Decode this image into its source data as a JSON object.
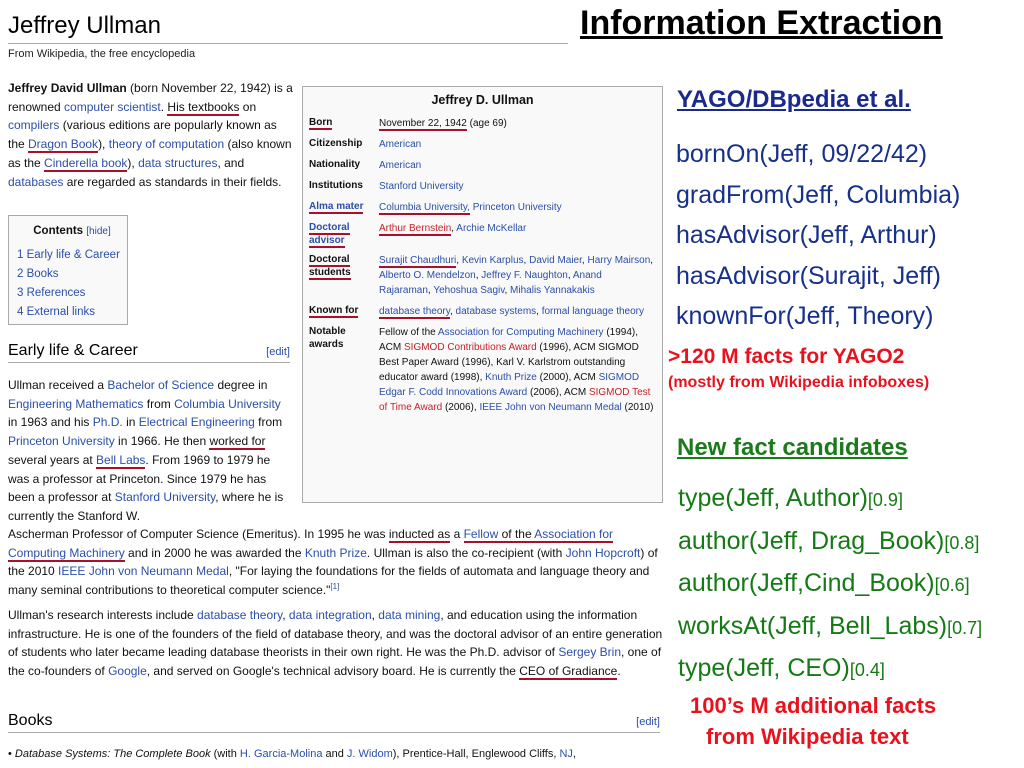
{
  "slide_title": "Information Extraction",
  "wiki": {
    "title": "Jeffrey Ullman",
    "subtitle": "From Wikipedia, the free encyclopedia",
    "intro": [
      {
        "t": "Jeffrey David Ullman",
        "k": "b"
      },
      {
        "t": " (born November 22, 1942) is a renowned ",
        "k": ""
      },
      {
        "t": "computer scientist",
        "k": "l"
      },
      {
        "t": ". ",
        "k": ""
      },
      {
        "t": "His textbooks",
        "k": "u"
      },
      {
        "t": " on ",
        "k": ""
      },
      {
        "t": "compilers",
        "k": "l"
      },
      {
        "t": " (various editions are popularly known as the ",
        "k": ""
      },
      {
        "t": "Dragon Book",
        "k": "l u"
      },
      {
        "t": "), ",
        "k": ""
      },
      {
        "t": "theory of computation",
        "k": "l"
      },
      {
        "t": " (also known as the ",
        "k": ""
      },
      {
        "t": "Cinderella book",
        "k": "l u"
      },
      {
        "t": "), ",
        "k": ""
      },
      {
        "t": "data structures",
        "k": "l"
      },
      {
        "t": ", and ",
        "k": ""
      },
      {
        "t": "databases",
        "k": "l"
      },
      {
        "t": " are regarded as standards in their fields.",
        "k": ""
      }
    ],
    "toc": {
      "title": "Contents",
      "hide": "[hide]",
      "items": [
        "1 Early life & Career",
        "2 Books",
        "3 References",
        "4 External links"
      ]
    },
    "early_heading": "Early life & Career",
    "edit_label": "[edit]",
    "early_para": [
      {
        "t": "Ullman received a ",
        "k": ""
      },
      {
        "t": "Bachelor of Science",
        "k": "l"
      },
      {
        "t": " degree in ",
        "k": ""
      },
      {
        "t": "Engineering Mathematics",
        "k": "l"
      },
      {
        "t": " from ",
        "k": ""
      },
      {
        "t": "Columbia University",
        "k": "l"
      },
      {
        "t": " in 1963 and his ",
        "k": ""
      },
      {
        "t": "Ph.D.",
        "k": "l"
      },
      {
        "t": " in ",
        "k": ""
      },
      {
        "t": "Electrical Engineering",
        "k": "l"
      },
      {
        "t": " from ",
        "k": ""
      },
      {
        "t": "Princeton University",
        "k": "l"
      },
      {
        "t": " in 1966. He then ",
        "k": ""
      },
      {
        "t": "worked for",
        "k": "u"
      },
      {
        "t": " several years at ",
        "k": ""
      },
      {
        "t": "Bell Labs",
        "k": "l u"
      },
      {
        "t": ". From 1969 to 1979 he was a professor at Princeton. Since 1979 he has been a professor at ",
        "k": ""
      },
      {
        "t": "Stanford University",
        "k": "l"
      },
      {
        "t": ", where he is currently the Stanford W.",
        "k": ""
      }
    ],
    "early_para2": [
      {
        "t": "Ascherman Professor of Computer Science (Emeritus). In 1995 he was ",
        "k": ""
      },
      {
        "t": "inducted as",
        "k": "u"
      },
      {
        "t": " a ",
        "k": ""
      },
      {
        "t": "Fellow",
        "k": "l u"
      },
      {
        "t": " of the ",
        "k": "u"
      },
      {
        "t": "Association for Computing Machinery",
        "k": "l u"
      },
      {
        "t": " and in 2000 he was awarded the ",
        "k": ""
      },
      {
        "t": "Knuth Prize",
        "k": "l"
      },
      {
        "t": ". Ullman is also the co-recipient (with ",
        "k": ""
      },
      {
        "t": "John Hopcroft",
        "k": "l"
      },
      {
        "t": ") of the 2010 ",
        "k": ""
      },
      {
        "t": "IEEE John von Neumann Medal",
        "k": "l"
      },
      {
        "t": ", \"For laying the foundations for the fields of automata and language theory and many seminal contributions to theoretical computer science.\"",
        "k": ""
      },
      {
        "t": "[1]",
        "k": "sup"
      }
    ],
    "research_para": [
      {
        "t": "Ullman's research interests include ",
        "k": ""
      },
      {
        "t": "database theory",
        "k": "l"
      },
      {
        "t": ", ",
        "k": ""
      },
      {
        "t": "data integration",
        "k": "l"
      },
      {
        "t": ", ",
        "k": ""
      },
      {
        "t": "data mining",
        "k": "l"
      },
      {
        "t": ", and education using the information infrastructure. He is one of the founders of the field of database theory, and was the doctoral advisor of an entire generation of students who later became leading database theorists in their own right. He was the Ph.D. advisor of ",
        "k": ""
      },
      {
        "t": "Sergey Brin",
        "k": "l"
      },
      {
        "t": ", one of the co-founders of ",
        "k": ""
      },
      {
        "t": "Google",
        "k": "l"
      },
      {
        "t": ", and served on Google's technical advisory board. He is currently the ",
        "k": ""
      },
      {
        "t": "CEO of Gradiance",
        "k": "u"
      },
      {
        "t": ".",
        "k": ""
      }
    ],
    "books_heading": "Books",
    "book_item": [
      {
        "t": "•  ",
        "k": ""
      },
      {
        "t": "Database Systems: The Complete Book",
        "k": "i"
      },
      {
        "t": " (with ",
        "k": ""
      },
      {
        "t": "H. Garcia-Molina",
        "k": "l"
      },
      {
        "t": " and ",
        "k": ""
      },
      {
        "t": "J. Widom",
        "k": "l"
      },
      {
        "t": "), Prentice-Hall, Englewood Cliffs, ",
        "k": ""
      },
      {
        "t": "NJ",
        "k": "l"
      },
      {
        "t": ",",
        "k": ""
      }
    ],
    "infobox": {
      "title": "Jeffrey D. Ullman",
      "rows": [
        {
          "label": "Born",
          "label_mark": true,
          "label_link": false,
          "value": [
            {
              "t": "November 22, 1942",
              "k": "u"
            },
            {
              "t": " (age 69)",
              "k": ""
            }
          ]
        },
        {
          "label": "Citizenship",
          "label_mark": false,
          "label_link": false,
          "value": [
            {
              "t": "American",
              "k": "l"
            }
          ]
        },
        {
          "label": "Nationality",
          "label_mark": false,
          "label_link": false,
          "value": [
            {
              "t": "American",
              "k": "l"
            }
          ]
        },
        {
          "label": "Institutions",
          "label_mark": false,
          "label_link": false,
          "value": [
            {
              "t": "Stanford University",
              "k": "l"
            }
          ]
        },
        {
          "label": "Alma mater",
          "label_mark": true,
          "label_link": true,
          "value": [
            {
              "t": "Columbia University,",
              "k": "l u"
            },
            {
              "t": " Princeton University",
              "k": "l"
            }
          ]
        },
        {
          "label": "Doctoral advisor",
          "label_mark": true,
          "label_link": true,
          "value": [
            {
              "t": "Arthur Bernstein",
              "k": "r u"
            },
            {
              "t": ", ",
              "k": ""
            },
            {
              "t": "Archie McKellar",
              "k": "l"
            }
          ]
        },
        {
          "label": "Doctoral students",
          "label_mark": true,
          "label_link": false,
          "value": [
            {
              "t": "Surajit Chaudhuri",
              "k": "l u"
            },
            {
              "t": ", ",
              "k": ""
            },
            {
              "t": "Kevin Karplus",
              "k": "l"
            },
            {
              "t": ", ",
              "k": ""
            },
            {
              "t": "David Maier",
              "k": "l"
            },
            {
              "t": ", ",
              "k": ""
            },
            {
              "t": "Harry Mairson",
              "k": "l"
            },
            {
              "t": ", ",
              "k": ""
            },
            {
              "t": "Alberto O. Mendelzon",
              "k": "l"
            },
            {
              "t": ", ",
              "k": ""
            },
            {
              "t": "Jeffrey F. Naughton",
              "k": "l"
            },
            {
              "t": ", ",
              "k": ""
            },
            {
              "t": "Anand Rajaraman",
              "k": "l"
            },
            {
              "t": ", ",
              "k": ""
            },
            {
              "t": "Yehoshua Sagiv",
              "k": "l"
            },
            {
              "t": ", ",
              "k": ""
            },
            {
              "t": "Mihalis Yannakakis",
              "k": "l"
            }
          ]
        },
        {
          "label": "Known for",
          "label_mark": true,
          "label_link": false,
          "value": [
            {
              "t": "database theory",
              "k": "l u"
            },
            {
              "t": ", ",
              "k": ""
            },
            {
              "t": "database systems",
              "k": "l"
            },
            {
              "t": ", ",
              "k": ""
            },
            {
              "t": "formal language theory",
              "k": "l"
            }
          ]
        },
        {
          "label": "Notable awards",
          "label_mark": false,
          "label_link": false,
          "value": [
            {
              "t": "Fellow of the ",
              "k": ""
            },
            {
              "t": "Association for Computing Machinery",
              "k": "l"
            },
            {
              "t": " (1994), ACM ",
              "k": ""
            },
            {
              "t": "SIGMOD Contributions Award",
              "k": "r"
            },
            {
              "t": " (1996), ACM SIGMOD Best Paper Award (1996), Karl V. Karlstrom outstanding educator award (1998), ",
              "k": ""
            },
            {
              "t": "Knuth Prize",
              "k": "l"
            },
            {
              "t": " (2000), ACM ",
              "k": ""
            },
            {
              "t": "SIGMOD Edgar F. Codd Innovations Award",
              "k": "l"
            },
            {
              "t": " (2006), ACM ",
              "k": ""
            },
            {
              "t": "SIGMOD Test of Time Award",
              "k": "r"
            },
            {
              "t": " (2006), ",
              "k": ""
            },
            {
              "t": "IEEE John von Neumann Medal",
              "k": "l"
            },
            {
              "t": " (2010)",
              "k": ""
            }
          ]
        }
      ]
    }
  },
  "yago": {
    "heading": "YAGO/DBpedia et al.",
    "facts": [
      "bornOn(Jeff, 09/22/42)",
      "gradFrom(Jeff, Columbia)",
      "hasAdvisor(Jeff, Arthur)",
      "hasAdvisor(Surajit, Jeff)",
      "knownFor(Jeff, Theory)"
    ],
    "note1": ">120 M facts for YAGO2",
    "note2": "(mostly from Wikipedia infoboxes)"
  },
  "candidates": {
    "heading": "New fact candidates",
    "facts": [
      {
        "fact": "type(Jeff, Author)",
        "conf": "[0.9]"
      },
      {
        "fact": "author(Jeff, Drag_Book)",
        "conf": "[0.8]"
      },
      {
        "fact": "author(Jeff,Cind_Book)",
        "conf": "[0.6]"
      },
      {
        "fact": "worksAt(Jeff, Bell_Labs)",
        "conf": "[0.7]"
      },
      {
        "fact": "type(Jeff, CEO)",
        "conf": "[0.4]"
      }
    ],
    "note_line1": "100’s M additional facts",
    "note_line2": "from Wikipedia text"
  },
  "colors": {
    "link": "#2b4ea8",
    "mark": "#a8102c",
    "yago": "#17308a",
    "candidate": "#157a15",
    "alert": "#e8121e"
  }
}
